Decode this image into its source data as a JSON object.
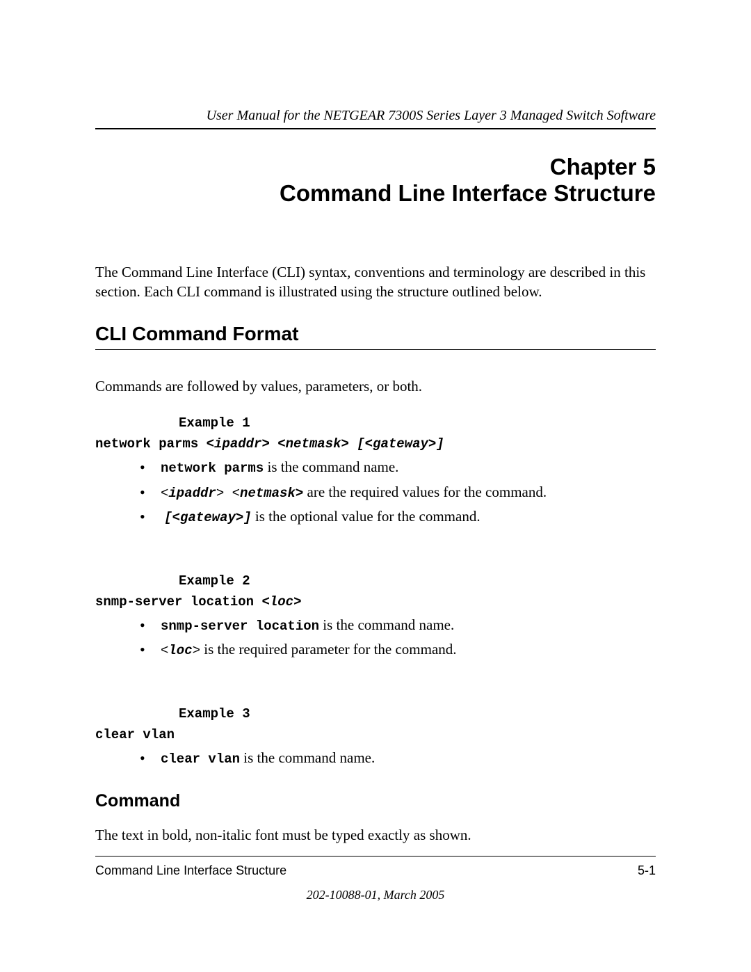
{
  "header": {
    "running_title": "User Manual for the NETGEAR 7300S Series Layer 3 Managed Switch Software"
  },
  "chapter": {
    "line1": "Chapter 5",
    "line2": "Command Line Interface Structure"
  },
  "intro": "The Command Line Interface (CLI) syntax, conventions and terminology are described in this section. Each CLI command is illustrated using the structure outlined below.",
  "section1": {
    "heading": "CLI Command Format",
    "intro": "Commands are followed by values, parameters, or both."
  },
  "example1": {
    "label": "Example 1",
    "cmd_prefix": "network parms ",
    "cmd_args": "<ipaddr> <netmask> [<gateway>]",
    "b1_code": "network parms",
    "b1_text": " is the command name.",
    "b2_pre": "<",
    "b2_arg1": "ipaddr",
    "b2_mid": "> <",
    "b2_arg2": "netmask>",
    "b2_text": " are the required values for the command.",
    "b3_code": "[<gateway>]",
    "b3_text": " is the optional value for the command."
  },
  "example2": {
    "label": "Example 2",
    "cmd_prefix": "snmp-server location ",
    "cmd_arg_pre": "<",
    "cmd_arg": "loc",
    "cmd_arg_post": ">",
    "b1_code": "snmp-server location",
    "b1_text": " is the command name.",
    "b2_pre": "<",
    "b2_arg": "loc",
    "b2_post": ">",
    "b2_text": " is the required parameter for the command."
  },
  "example3": {
    "label": "Example 3",
    "cmd": "clear vlan",
    "b1_code": "clear vlan",
    "b1_text": " is the command name."
  },
  "section2": {
    "heading": "Command",
    "body": "The text in bold, non-italic font must be typed exactly as shown."
  },
  "footer": {
    "left": "Command Line Interface Structure",
    "right": "5-1",
    "date": "202-10088-01, March 2005"
  }
}
